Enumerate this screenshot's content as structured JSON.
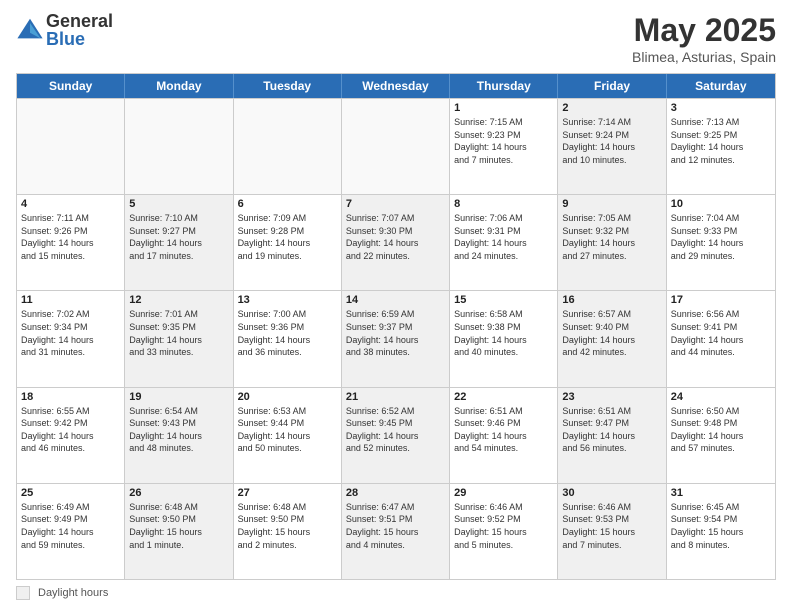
{
  "logo": {
    "general": "General",
    "blue": "Blue"
  },
  "title": {
    "month": "May 2025",
    "location": "Blimea, Asturias, Spain"
  },
  "header_days": [
    "Sunday",
    "Monday",
    "Tuesday",
    "Wednesday",
    "Thursday",
    "Friday",
    "Saturday"
  ],
  "weeks": [
    [
      {
        "day": "",
        "info": "",
        "empty": true
      },
      {
        "day": "",
        "info": "",
        "empty": true
      },
      {
        "day": "",
        "info": "",
        "empty": true
      },
      {
        "day": "",
        "info": "",
        "empty": true
      },
      {
        "day": "1",
        "info": "Sunrise: 7:15 AM\nSunset: 9:23 PM\nDaylight: 14 hours\nand 7 minutes.",
        "empty": false
      },
      {
        "day": "2",
        "info": "Sunrise: 7:14 AM\nSunset: 9:24 PM\nDaylight: 14 hours\nand 10 minutes.",
        "empty": false,
        "shaded": true
      },
      {
        "day": "3",
        "info": "Sunrise: 7:13 AM\nSunset: 9:25 PM\nDaylight: 14 hours\nand 12 minutes.",
        "empty": false
      }
    ],
    [
      {
        "day": "4",
        "info": "Sunrise: 7:11 AM\nSunset: 9:26 PM\nDaylight: 14 hours\nand 15 minutes.",
        "empty": false
      },
      {
        "day": "5",
        "info": "Sunrise: 7:10 AM\nSunset: 9:27 PM\nDaylight: 14 hours\nand 17 minutes.",
        "empty": false,
        "shaded": true
      },
      {
        "day": "6",
        "info": "Sunrise: 7:09 AM\nSunset: 9:28 PM\nDaylight: 14 hours\nand 19 minutes.",
        "empty": false
      },
      {
        "day": "7",
        "info": "Sunrise: 7:07 AM\nSunset: 9:30 PM\nDaylight: 14 hours\nand 22 minutes.",
        "empty": false,
        "shaded": true
      },
      {
        "day": "8",
        "info": "Sunrise: 7:06 AM\nSunset: 9:31 PM\nDaylight: 14 hours\nand 24 minutes.",
        "empty": false
      },
      {
        "day": "9",
        "info": "Sunrise: 7:05 AM\nSunset: 9:32 PM\nDaylight: 14 hours\nand 27 minutes.",
        "empty": false,
        "shaded": true
      },
      {
        "day": "10",
        "info": "Sunrise: 7:04 AM\nSunset: 9:33 PM\nDaylight: 14 hours\nand 29 minutes.",
        "empty": false
      }
    ],
    [
      {
        "day": "11",
        "info": "Sunrise: 7:02 AM\nSunset: 9:34 PM\nDaylight: 14 hours\nand 31 minutes.",
        "empty": false
      },
      {
        "day": "12",
        "info": "Sunrise: 7:01 AM\nSunset: 9:35 PM\nDaylight: 14 hours\nand 33 minutes.",
        "empty": false,
        "shaded": true
      },
      {
        "day": "13",
        "info": "Sunrise: 7:00 AM\nSunset: 9:36 PM\nDaylight: 14 hours\nand 36 minutes.",
        "empty": false
      },
      {
        "day": "14",
        "info": "Sunrise: 6:59 AM\nSunset: 9:37 PM\nDaylight: 14 hours\nand 38 minutes.",
        "empty": false,
        "shaded": true
      },
      {
        "day": "15",
        "info": "Sunrise: 6:58 AM\nSunset: 9:38 PM\nDaylight: 14 hours\nand 40 minutes.",
        "empty": false
      },
      {
        "day": "16",
        "info": "Sunrise: 6:57 AM\nSunset: 9:40 PM\nDaylight: 14 hours\nand 42 minutes.",
        "empty": false,
        "shaded": true
      },
      {
        "day": "17",
        "info": "Sunrise: 6:56 AM\nSunset: 9:41 PM\nDaylight: 14 hours\nand 44 minutes.",
        "empty": false
      }
    ],
    [
      {
        "day": "18",
        "info": "Sunrise: 6:55 AM\nSunset: 9:42 PM\nDaylight: 14 hours\nand 46 minutes.",
        "empty": false
      },
      {
        "day": "19",
        "info": "Sunrise: 6:54 AM\nSunset: 9:43 PM\nDaylight: 14 hours\nand 48 minutes.",
        "empty": false,
        "shaded": true
      },
      {
        "day": "20",
        "info": "Sunrise: 6:53 AM\nSunset: 9:44 PM\nDaylight: 14 hours\nand 50 minutes.",
        "empty": false
      },
      {
        "day": "21",
        "info": "Sunrise: 6:52 AM\nSunset: 9:45 PM\nDaylight: 14 hours\nand 52 minutes.",
        "empty": false,
        "shaded": true
      },
      {
        "day": "22",
        "info": "Sunrise: 6:51 AM\nSunset: 9:46 PM\nDaylight: 14 hours\nand 54 minutes.",
        "empty": false
      },
      {
        "day": "23",
        "info": "Sunrise: 6:51 AM\nSunset: 9:47 PM\nDaylight: 14 hours\nand 56 minutes.",
        "empty": false,
        "shaded": true
      },
      {
        "day": "24",
        "info": "Sunrise: 6:50 AM\nSunset: 9:48 PM\nDaylight: 14 hours\nand 57 minutes.",
        "empty": false
      }
    ],
    [
      {
        "day": "25",
        "info": "Sunrise: 6:49 AM\nSunset: 9:49 PM\nDaylight: 14 hours\nand 59 minutes.",
        "empty": false
      },
      {
        "day": "26",
        "info": "Sunrise: 6:48 AM\nSunset: 9:50 PM\nDaylight: 15 hours\nand 1 minute.",
        "empty": false,
        "shaded": true
      },
      {
        "day": "27",
        "info": "Sunrise: 6:48 AM\nSunset: 9:50 PM\nDaylight: 15 hours\nand 2 minutes.",
        "empty": false
      },
      {
        "day": "28",
        "info": "Sunrise: 6:47 AM\nSunset: 9:51 PM\nDaylight: 15 hours\nand 4 minutes.",
        "empty": false,
        "shaded": true
      },
      {
        "day": "29",
        "info": "Sunrise: 6:46 AM\nSunset: 9:52 PM\nDaylight: 15 hours\nand 5 minutes.",
        "empty": false
      },
      {
        "day": "30",
        "info": "Sunrise: 6:46 AM\nSunset: 9:53 PM\nDaylight: 15 hours\nand 7 minutes.",
        "empty": false,
        "shaded": true
      },
      {
        "day": "31",
        "info": "Sunrise: 6:45 AM\nSunset: 9:54 PM\nDaylight: 15 hours\nand 8 minutes.",
        "empty": false
      }
    ]
  ],
  "legend": {
    "box_label": "Daylight hours"
  }
}
